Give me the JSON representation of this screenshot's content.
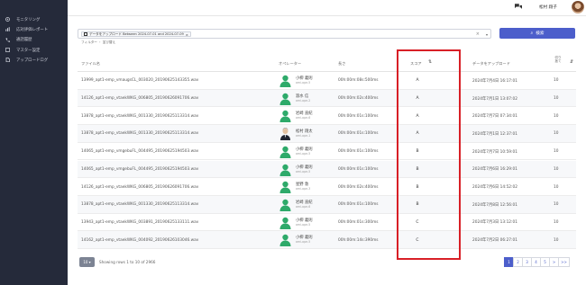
{
  "sidebar": {
    "items": [
      {
        "label": "モニタリング",
        "icon": "gear-icon"
      },
      {
        "label": "応対評価レポート",
        "icon": "chart-icon"
      },
      {
        "label": "通話履歴",
        "icon": "phone-icon"
      },
      {
        "label": "マスター設定",
        "icon": "settings-icon"
      },
      {
        "label": "アップロードログ",
        "icon": "file-icon"
      }
    ]
  },
  "header": {
    "user_name": "松村 翔子"
  },
  "search": {
    "chip_label": "データをアップロード Between 2024-07-01 and 2024-07-09",
    "chip_close": "×",
    "clear": "×",
    "dropdown": "▾",
    "button_label": "検索",
    "filter_links": "フィルター ・ 並び替え"
  },
  "table": {
    "headers": {
      "filename": "ファイル名",
      "operator": "オペレーター",
      "length": "長さ",
      "score": "スコア",
      "uploaded": "データをアップロード",
      "cut": "切り\n捨て"
    },
    "rows": [
      {
        "filename": "13999_apt1-emp_vmaugsCL_003020_20190625143355.wav",
        "op_name": "小柳 義則",
        "op_sub": "ami-ope-5",
        "length": "00h:00m:08s:500ms",
        "score": "A",
        "date": "2024年7月4日 16:17:01",
        "cut": "10",
        "avatar": "green"
      },
      {
        "filename": "14126_apt1-emp_vtaekWKG_006805_20190626091706.wav",
        "op_name": "淑水 信",
        "op_sub": "ami-ope-2",
        "length": "00h:00m:02s:400ms",
        "score": "A",
        "date": "2024年7月1日 13:07:02",
        "cut": "10",
        "avatar": "green"
      },
      {
        "filename": "13878_apt1-emp_vtaekWKG_001330_20190625113314.wav",
        "op_name": "岩崎 直紀",
        "op_sub": "ami-ope-6",
        "length": "00h:00m:01s:100ms",
        "score": "A",
        "date": "2024年7月7日 07:34:01",
        "cut": "10",
        "avatar": "green"
      },
      {
        "filename": "13878_apt1-emp_vtaekWKG_001330_20190625113314.wav",
        "op_name": "松村 翔太",
        "op_sub": "ami-ope-1",
        "length": "00h:00m:01s:100ms",
        "score": "A",
        "date": "2024年7月1日 12:37:01",
        "cut": "10",
        "avatar": "photo"
      },
      {
        "filename": "14065_apt1-emp_vmgebuFL_004495_20190625194503.wav",
        "op_name": "小柳 義則",
        "op_sub": "ami-ope-5",
        "length": "00h:00m:01s:100ms",
        "score": "B",
        "date": "2024年7月7日 10:59:01",
        "cut": "10",
        "avatar": "green"
      },
      {
        "filename": "14065_apt1-emp_vmgebuFL_004495_20190625194503.wav",
        "op_name": "小柳 義則",
        "op_sub": "ami-ope-5",
        "length": "00h:00m:01s:100ms",
        "score": "B",
        "date": "2024年7月6日 16:29:01",
        "cut": "10",
        "avatar": "green"
      },
      {
        "filename": "14126_apt1-emp_vtaekWKG_006805_20190626091706.wav",
        "op_name": "星野 敦",
        "op_sub": "ami-ope-3",
        "length": "00h:00m:02s:400ms",
        "score": "B",
        "date": "2024年7月6日 14:52:02",
        "cut": "10",
        "avatar": "green"
      },
      {
        "filename": "13878_apt1-emp_vtaekWKG_001330_20190625113314.wav",
        "op_name": "岩崎 直紀",
        "op_sub": "ami-ope-6",
        "length": "00h:00m:01s:100ms",
        "score": "B",
        "date": "2024年7月8日 12:56:01",
        "cut": "10",
        "avatar": "green"
      },
      {
        "filename": "13943_apt1-emp_vtaekWKG_003891_20190625133111.wav",
        "op_name": "小柳 義則",
        "op_sub": "ami-ope-5",
        "length": "00h:00m:01s:300ms",
        "score": "C",
        "date": "2024年7月3日 13:12:01",
        "cut": "10",
        "avatar": "green"
      },
      {
        "filename": "14162_apt1-emp_vtaekWKG_004092_20190626103046.wav",
        "op_name": "小柳 義則",
        "op_sub": "ami-ope-5",
        "length": "00h:00m:14s:390ms",
        "score": "C",
        "date": "2024年7月2日 06:27:01",
        "cut": "10",
        "avatar": "green"
      }
    ]
  },
  "footer": {
    "page_size": "10 ▾",
    "showing": "Showing rows 1 to 10 of 2966",
    "pages": [
      "1",
      "2",
      "3",
      "4",
      "5",
      ">",
      ">>"
    ]
  },
  "colors": {
    "sidebar_bg": "#252a3a",
    "accent": "#4c5ecb",
    "highlight": "#d81f26",
    "avatar_green": "#2eaa6a"
  }
}
